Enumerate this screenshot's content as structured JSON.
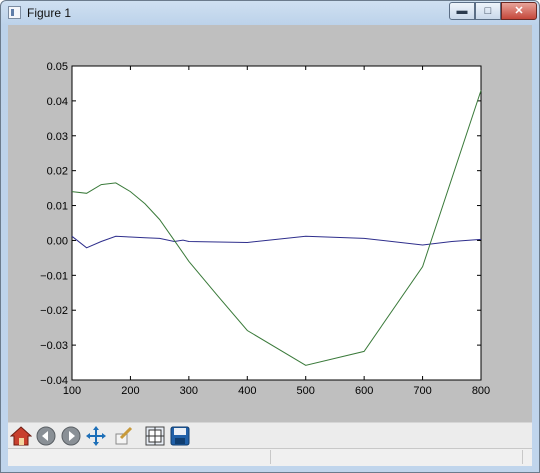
{
  "window": {
    "title": "Figure 1",
    "minimize_glyph": "▬",
    "maximize_glyph": "□",
    "close_glyph": "✕"
  },
  "toolbar": {
    "buttons": [
      {
        "name": "home",
        "icon": "home-icon"
      },
      {
        "name": "back",
        "icon": "arrow-left-icon"
      },
      {
        "name": "forward",
        "icon": "arrow-right-icon"
      },
      {
        "name": "pan",
        "icon": "move-arrows-icon"
      },
      {
        "name": "zoom",
        "icon": "zoom-rect-icon"
      },
      {
        "name": "configure-subplots",
        "icon": "subplots-icon"
      },
      {
        "name": "save",
        "icon": "floppy-disk-icon"
      }
    ]
  },
  "chart_data": {
    "type": "line",
    "title": "",
    "xlabel": "",
    "ylabel": "",
    "xlim": [
      100,
      800
    ],
    "ylim": [
      -0.04,
      0.05
    ],
    "xticks": [
      "100",
      "200",
      "300",
      "400",
      "500",
      "600",
      "700",
      "800"
    ],
    "yticks": [
      "0.05",
      "0.04",
      "0.03",
      "0.02",
      "0.01",
      "0.00",
      "−0.01",
      "−0.02",
      "−0.03",
      "−0.04"
    ],
    "grid": false,
    "series": [
      {
        "color": "#2e2e8c",
        "x": [
          100,
          125,
          150,
          175,
          200,
          225,
          250,
          275,
          290,
          300,
          400,
          500,
          600,
          700,
          750,
          800
        ],
        "y": [
          0.0012,
          -0.0021,
          -0.0003,
          0.0012,
          0.001,
          0.0008,
          0.0006,
          -0.0003,
          0.0001,
          -0.0003,
          -0.0006,
          0.0012,
          0.0006,
          -0.0013,
          -0.0003,
          0.0003
        ]
      },
      {
        "color": "#3a7a3a",
        "x": [
          100,
          125,
          150,
          175,
          200,
          225,
          250,
          275,
          300,
          350,
          400,
          500,
          600,
          700,
          800
        ],
        "y": [
          0.014,
          0.0135,
          0.016,
          0.0165,
          0.014,
          0.0105,
          0.006,
          0.0,
          -0.006,
          -0.016,
          -0.0258,
          -0.0358,
          -0.0318,
          -0.0075,
          0.043
        ]
      }
    ]
  }
}
